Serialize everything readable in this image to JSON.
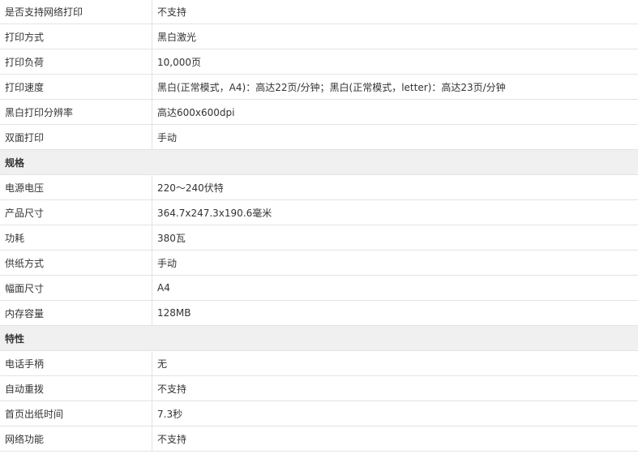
{
  "rows": [
    {
      "type": "row",
      "label": "是否支持网络打印",
      "value": "不支持"
    },
    {
      "type": "row",
      "label": "打印方式",
      "value": "黑白激光"
    },
    {
      "type": "row",
      "label": "打印负荷",
      "value": "10,000页"
    },
    {
      "type": "row",
      "label": "打印速度",
      "value": "黑白(正常模式，A4)：高达22页/分钟；黑白(正常模式，letter)：高达23页/分钟"
    },
    {
      "type": "row",
      "label": "黑白打印分辨率",
      "value": "高达600x600dpi"
    },
    {
      "type": "row",
      "label": "双面打印",
      "value": "手动"
    },
    {
      "type": "section",
      "label": "规格"
    },
    {
      "type": "row",
      "label": "电源电压",
      "value": "220～240伏特"
    },
    {
      "type": "row",
      "label": "产品尺寸",
      "value": "364.7x247.3x190.6毫米"
    },
    {
      "type": "row",
      "label": "功耗",
      "value": "380瓦"
    },
    {
      "type": "row",
      "label": "供纸方式",
      "value": "手动"
    },
    {
      "type": "row",
      "label": "幅面尺寸",
      "value": "A4"
    },
    {
      "type": "row",
      "label": "内存容量",
      "value": "128MB"
    },
    {
      "type": "section",
      "label": "特性"
    },
    {
      "type": "row",
      "label": "电话手柄",
      "value": "无"
    },
    {
      "type": "row",
      "label": "自动重拨",
      "value": "不支持"
    },
    {
      "type": "row",
      "label": "首页出纸时间",
      "value": "7.3秒"
    },
    {
      "type": "row",
      "label": "网络功能",
      "value": "不支持"
    }
  ]
}
